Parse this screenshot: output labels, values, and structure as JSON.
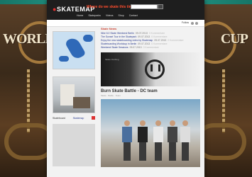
{
  "background": {
    "left_word": "WORLD",
    "right_word": "CUP"
  },
  "site": {
    "logo": "SKATEMAP",
    "question": "Where do we skate this time?",
    "nav": [
      "Home",
      "Skateparks",
      "Videos",
      "Shop",
      "Contact"
    ],
    "social": "Follow",
    "news_heading": "Skate News",
    "news": [
      {
        "title": "Nike 6.0 Skate Weekend Berlin",
        "date": "09.07.2013",
        "comments": "0 Kommentare"
      },
      {
        "title": "The Sunset Tour in the Skatepark",
        "date": "09.07.2013",
        "comments": "0 Kommentare"
      },
      {
        "title": "Enjoy the new skateboarding video by Skatemap",
        "date": "09.07.2013",
        "comments": "0 Kommentare"
      },
      {
        "title": "Skateboarding Worldcup in Berlin",
        "date": "09.07.2013",
        "comments": "0 Kommentare"
      },
      {
        "title": "Weekend Skate Sessions",
        "date": "09.07.2013",
        "comments": "0 Kommentare"
      }
    ],
    "feature_caption": "Skate Clothing",
    "post_title": "Burn Skate Battle - DC team",
    "post_meta": "Skate · Battle · Team",
    "sidebar_label": "Skateboard",
    "sidebar_link": "Skatemap"
  },
  "colors": {
    "frame": "#1f8c7c",
    "accent_red": "#ff4d2e",
    "link_blue": "#2a3b8f"
  }
}
